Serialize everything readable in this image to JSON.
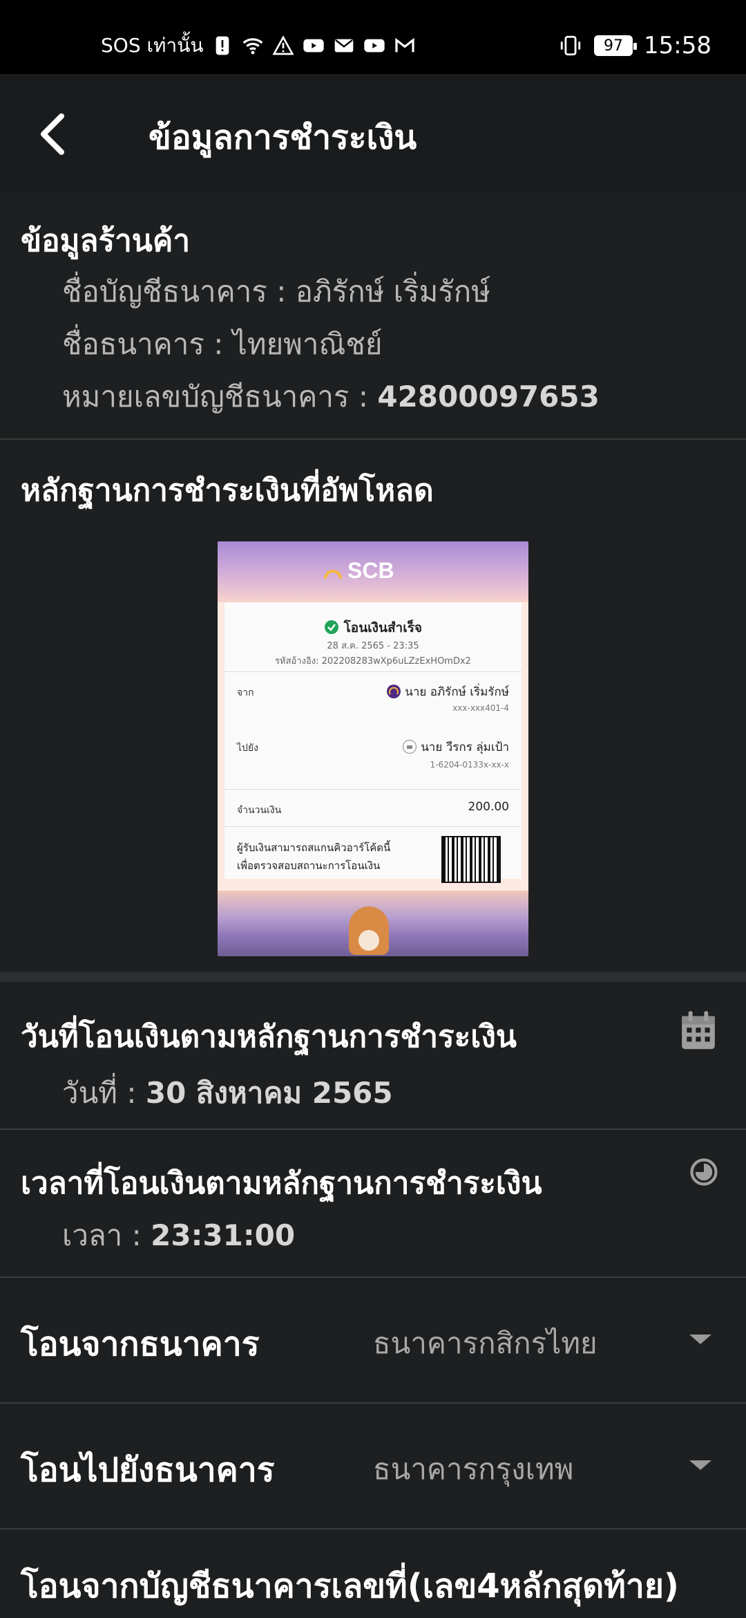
{
  "status_bar": {
    "carrier": "SOS เท่านั้น",
    "battery": "97",
    "time": "15:58"
  },
  "app_bar": {
    "title": "ข้อมูลการชำระเงิน"
  },
  "store_info": {
    "heading": "ข้อมูลร้านค้า",
    "account_name_label": "ชื่อบัญชีธนาคาร :",
    "account_name": "อภิรักษ์ เริ่มรักษ์",
    "bank_label": "ชื่อธนาคาร :",
    "bank_name": "ไทยพาณิชย์",
    "account_no_label": "หมายเลขบัญชีธนาคาร :",
    "account_no": "42800097653"
  },
  "proof": {
    "heading": "หลักฐานการชำระเงินที่อัพโหลด",
    "receipt": {
      "logo": "SCB",
      "status": "โอนเงินสำเร็จ",
      "datetime": "28 ส.ค. 2565 - 23:35",
      "ref": "รหัสอ้างอิง: 202208283wXp6uLZzExHOmDx2",
      "from_label": "จาก",
      "from_name": "นาย อภิรักษ์ เริ่มรักษ์",
      "from_acct": "xxx-xxx401-4",
      "to_label": "ไปยัง",
      "to_name": "นาย วีรกร ลุ่มเป้า",
      "to_acct": "1-6204-0133x-xx-x",
      "amount_label": "จำนวนเงิน",
      "amount": "200.00",
      "note_line1": "ผู้รับเงินสามารถสแกนคิวอาร์โค้ดนี้",
      "note_line2": "เพื่อตรวจสอบสถานะการโอนเงิน"
    }
  },
  "transfer_date": {
    "heading": "วันที่โอนเงินตามหลักฐานการชำระเงิน",
    "label": "วันที่ :",
    "value": "30 สิงหาคม 2565",
    "icon": "calendar-icon"
  },
  "transfer_time": {
    "heading": "เวลาที่โอนเงินตามหลักฐานการชำระเงิน",
    "label": "เวลา :",
    "value": "23:31:00",
    "icon": "clock-icon"
  },
  "from_bank": {
    "label": "โอนจากธนาคาร",
    "value": "ธนาคารกสิกรไทย"
  },
  "to_bank": {
    "label": "โอนไปยังธนาคาร",
    "value": "ธนาคารกรุงเทพ"
  },
  "from_account": {
    "label": "โอนจากบัญชีธนาคารเลขที่(เลข4หลักสุดท้าย)"
  }
}
